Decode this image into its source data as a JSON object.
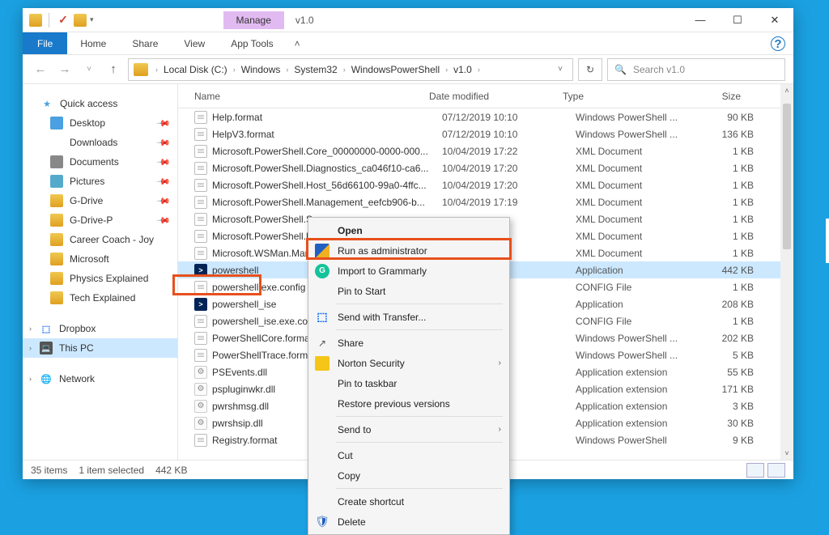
{
  "window": {
    "context_tab": "Manage",
    "title": "v1.0",
    "ribbon": {
      "file": "File",
      "home": "Home",
      "share": "Share",
      "view": "View",
      "apptools": "App Tools"
    }
  },
  "breadcrumb": [
    "Local Disk (C:)",
    "Windows",
    "System32",
    "WindowsPowerShell",
    "v1.0"
  ],
  "search_placeholder": "Search v1.0",
  "sidebar": {
    "quick": "Quick access",
    "items": [
      {
        "label": "Desktop",
        "pin": true
      },
      {
        "label": "Downloads",
        "pin": true
      },
      {
        "label": "Documents",
        "pin": true
      },
      {
        "label": "Pictures",
        "pin": true
      },
      {
        "label": "G-Drive",
        "pin": true
      },
      {
        "label": "G-Drive-P",
        "pin": true
      },
      {
        "label": "Career Coach - Joy",
        "pin": false
      },
      {
        "label": "Microsoft",
        "pin": false
      },
      {
        "label": "Physics Explained",
        "pin": false
      },
      {
        "label": "Tech Explained",
        "pin": false
      }
    ],
    "dropbox": "Dropbox",
    "thispc": "This PC",
    "network": "Network"
  },
  "columns": {
    "name": "Name",
    "date": "Date modified",
    "type": "Type",
    "size": "Size"
  },
  "files": [
    {
      "ico": "file",
      "name": "Help.format",
      "date": "07/12/2019 10:10",
      "type": "Windows PowerShell ...",
      "size": "90 KB"
    },
    {
      "ico": "file",
      "name": "HelpV3.format",
      "date": "07/12/2019 10:10",
      "type": "Windows PowerShell ...",
      "size": "136 KB"
    },
    {
      "ico": "file",
      "name": "Microsoft.PowerShell.Core_00000000-0000-000...",
      "date": "10/04/2019 17:22",
      "type": "XML Document",
      "size": "1 KB"
    },
    {
      "ico": "file",
      "name": "Microsoft.PowerShell.Diagnostics_ca046f10-ca6...",
      "date": "10/04/2019 17:20",
      "type": "XML Document",
      "size": "1 KB"
    },
    {
      "ico": "file",
      "name": "Microsoft.PowerShell.Host_56d66100-99a0-4ffc...",
      "date": "10/04/2019 17:20",
      "type": "XML Document",
      "size": "1 KB"
    },
    {
      "ico": "file",
      "name": "Microsoft.PowerShell.Management_eefcb906-b...",
      "date": "10/04/2019 17:19",
      "type": "XML Document",
      "size": "1 KB"
    },
    {
      "ico": "file",
      "name": "Microsoft.PowerShell.Secu",
      "date": "",
      "type": "XML Document",
      "size": "1 KB"
    },
    {
      "ico": "file",
      "name": "Microsoft.PowerShell.Utili",
      "date": "",
      "type": "XML Document",
      "size": "1 KB"
    },
    {
      "ico": "file",
      "name": "Microsoft.WSMan.Manag",
      "date": "",
      "type": "XML Document",
      "size": "1 KB"
    },
    {
      "ico": "ps",
      "name": "powershell",
      "date": "",
      "type": "Application",
      "size": "442 KB",
      "selected": true
    },
    {
      "ico": "file",
      "name": "powershell.exe.config",
      "date": "",
      "type": "CONFIG File",
      "size": "1 KB"
    },
    {
      "ico": "ps",
      "name": "powershell_ise",
      "date": "",
      "type": "Application",
      "size": "208 KB"
    },
    {
      "ico": "file",
      "name": "powershell_ise.exe.config",
      "date": "",
      "type": "CONFIG File",
      "size": "1 KB"
    },
    {
      "ico": "file",
      "name": "PowerShellCore.format",
      "date": "",
      "type": "Windows PowerShell ...",
      "size": "202 KB"
    },
    {
      "ico": "file",
      "name": "PowerShellTrace.format",
      "date": "",
      "type": "Windows PowerShell ...",
      "size": "5 KB"
    },
    {
      "ico": "dll",
      "name": "PSEvents.dll",
      "date": "",
      "type": "Application extension",
      "size": "55 KB"
    },
    {
      "ico": "dll",
      "name": "pspluginwkr.dll",
      "date": "",
      "type": "Application extension",
      "size": "171 KB"
    },
    {
      "ico": "dll",
      "name": "pwrshmsg.dll",
      "date": "",
      "type": "Application extension",
      "size": "3 KB"
    },
    {
      "ico": "dll",
      "name": "pwrshsip.dll",
      "date": "",
      "type": "Application extension",
      "size": "30 KB"
    },
    {
      "ico": "file",
      "name": "Registry.format",
      "date": "",
      "type": "Windows PowerShell",
      "size": "9 KB"
    }
  ],
  "status": {
    "count": "35 items",
    "selected": "1 item selected",
    "size": "442 KB"
  },
  "context_menu": {
    "open": "Open",
    "runas": "Run as administrator",
    "grammarly": "Import to Grammarly",
    "pinstart": "Pin to Start",
    "transfer": "Send with Transfer...",
    "share": "Share",
    "norton": "Norton Security",
    "pintask": "Pin to taskbar",
    "restore": "Restore previous versions",
    "sendto": "Send to",
    "cut": "Cut",
    "copy": "Copy",
    "shortcut": "Create shortcut",
    "delete": "Delete"
  }
}
